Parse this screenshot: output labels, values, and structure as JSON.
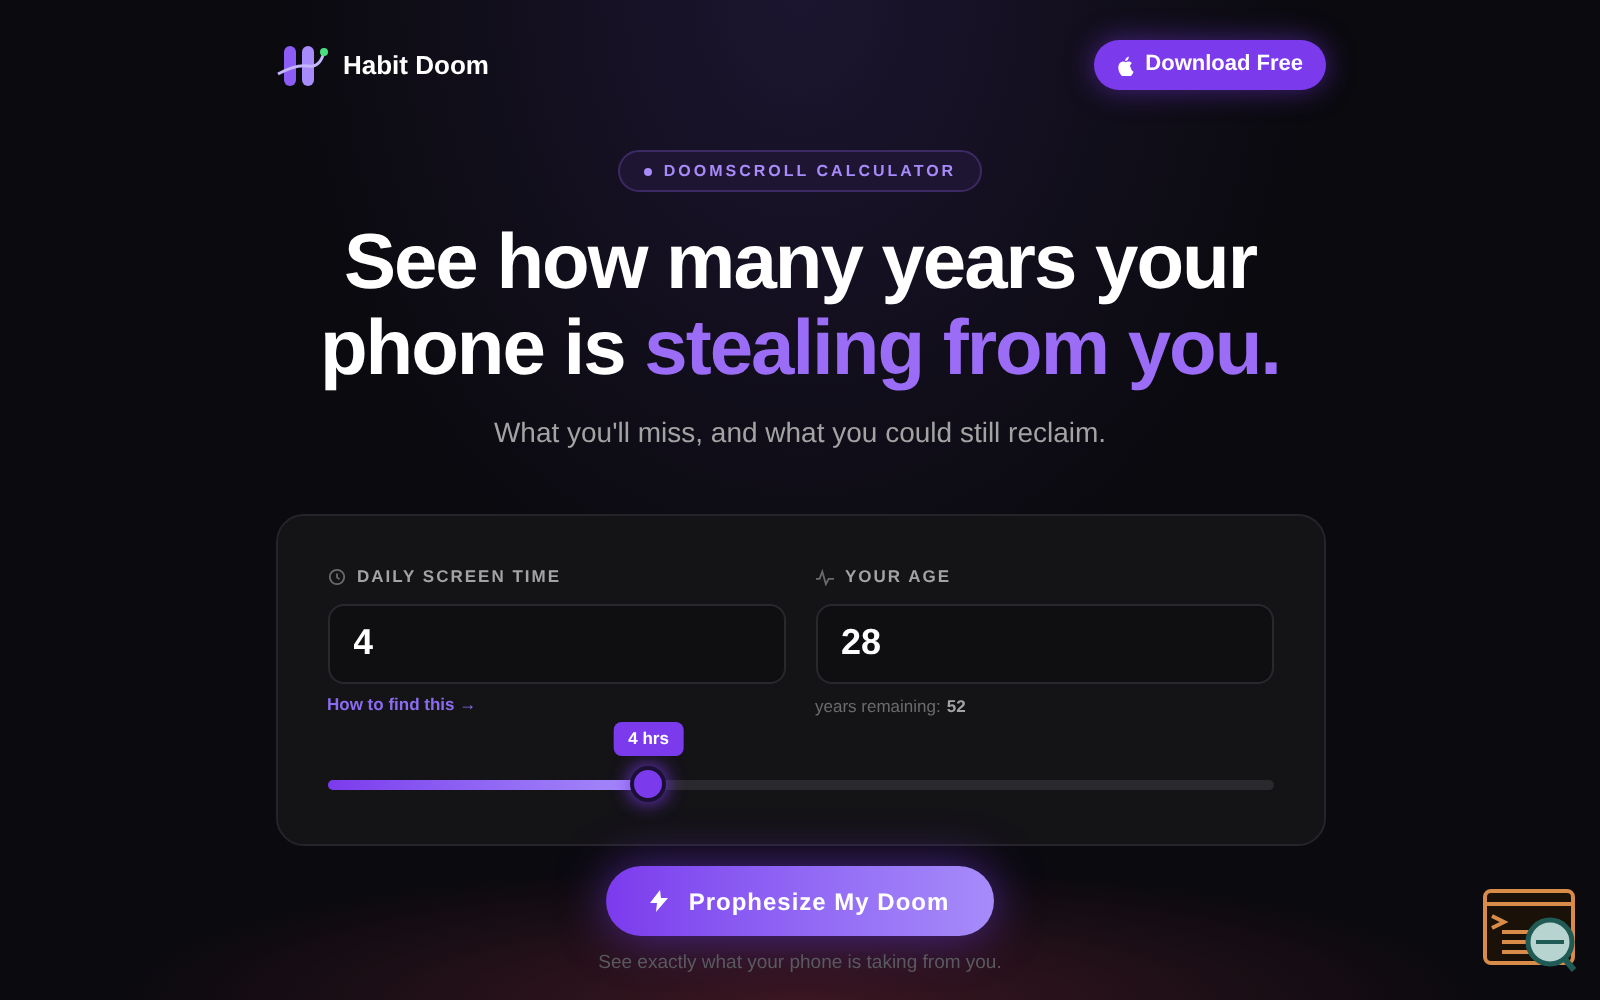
{
  "nav": {
    "brand": "Habit Doom",
    "download_button": "Download Free"
  },
  "badge": "DOOMSCROLL CALCULATOR",
  "headline": {
    "line_1": "See how many years your",
    "line_2_plain": "phone is",
    "line_2_accent": "stealing from you."
  },
  "subtitle": "What you'll miss, and what you could still reclaim.",
  "calculator": {
    "screen_time": {
      "label": "DAILY SCREEN TIME",
      "value": "4",
      "help_link": "How to find this →"
    },
    "age": {
      "label": "YOUR AGE",
      "value": "28",
      "remaining_label": "years remaining:",
      "remaining_value": "52"
    },
    "slider": {
      "tooltip": "4 hrs",
      "level": 0.34
    }
  },
  "cta_button": "Prophesize My Doom",
  "cta_note": "See exactly what your phone is taking from you."
}
